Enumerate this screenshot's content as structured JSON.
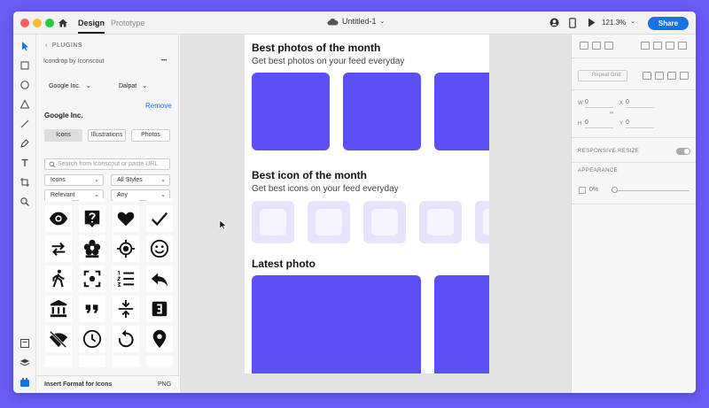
{
  "window": {
    "tabs": {
      "design": "Design",
      "prototype": "Prototype"
    },
    "doc_title": "Untitled-1",
    "zoom": "121.3%",
    "share": "Share"
  },
  "plugins": {
    "back_label": "PLUGINS",
    "plugin_name": "Icondrop by Iconscout",
    "more": "•••",
    "provider_select": "Google Inc.",
    "style_select": "Dalpat",
    "remove": "Remove",
    "provider_title": "Google Inc.",
    "tabs": [
      "Icons",
      "Illustrations",
      "Photos"
    ],
    "search_placeholder": "Search from Iconscout or paste URL",
    "filter_type": "Icons",
    "filter_style": "All Styles",
    "filter_sort": "Relevant",
    "filter_any": "Any",
    "icons": [
      "eye-icon",
      "help-bubble-icon",
      "heart-icon",
      "check-icon",
      "swap-arrows-icon",
      "flower-icon",
      "gps-target-icon",
      "smiley-icon",
      "walking-icon",
      "center-focus-icon",
      "numbered-list-icon",
      "reply-icon",
      "bank-icon",
      "quote-icon",
      "vertical-compress-icon",
      "looks-3-icon",
      "signal-off-icon",
      "clock-icon",
      "replay-icon",
      "location-pin-icon"
    ],
    "footer_label": "Insert Format for Icons",
    "footer_format": "PNG"
  },
  "artboard": {
    "section1_title": "Best photos of the month",
    "section1_sub": "Get best photos on your feed everyday",
    "section2_title": "Best icon of the month",
    "section2_sub": "Get best icons on your feed everyday",
    "section3_title": "Latest photo",
    "accent_color": "#5b4ff5",
    "icon_tile_color": "#e6e3fc"
  },
  "props": {
    "repeat_grid": "Repeat Grid",
    "w_label": "W",
    "w_value": "0",
    "x_label": "X",
    "x_value": "0",
    "h_label": "H",
    "h_value": "0",
    "y_label": "Y",
    "y_value": "0",
    "responsive_resize": "RESPONSIVE RESIZE",
    "appearance": "APPEARANCE",
    "opacity": "0%"
  }
}
